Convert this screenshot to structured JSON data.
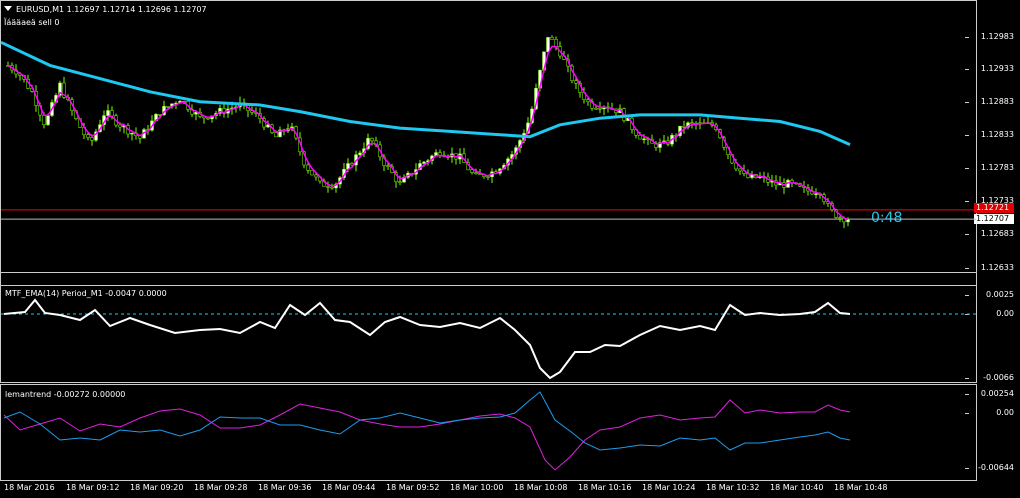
{
  "header": {
    "symbol_line": "EURUSD,M1  1.12697 1.12714 1.12696 1.12707",
    "subtitle": "Ïáääaeä sell 0"
  },
  "main_axis": [
    "1.12983",
    "1.12933",
    "1.12883",
    "1.12833",
    "1.12783",
    "1.12733",
    "1.12683",
    "1.12633"
  ],
  "current_price": "1.12707",
  "red_level": "1.12721",
  "countdown": "0:48",
  "indicator1": {
    "title": "MTF_EMA(14) Period_M1 -0.0047 0.0000",
    "axis": [
      "0.0025",
      "0.00",
      "-0.0066"
    ]
  },
  "indicator2": {
    "title": "lemantrend -0.00272 0.00000",
    "axis": [
      "0.00254",
      "0.00",
      "-0.00644"
    ]
  },
  "time_axis": [
    "18 Mar 2016",
    "18 Mar 09:12",
    "18 Mar 09:20",
    "18 Mar 09:28",
    "18 Mar 09:36",
    "18 Mar 09:44",
    "18 Mar 09:52",
    "18 Mar 10:00",
    "18 Mar 10:08",
    "18 Mar 10:16",
    "18 Mar 10:24",
    "18 Mar 10:32",
    "18 Mar 10:40",
    "18 Mar 10:48"
  ],
  "colors": {
    "bull_candle": "#ffffff",
    "bear_candle": "#000000",
    "wick": "#7fff00",
    "ma_fast": "#ff00ff",
    "ma_slow": "#1ec8f0",
    "red_line": "#ff0000",
    "ema_line": "#ffffff",
    "trend_pink": "#e020e0",
    "trend_blue": "#1e9cf0"
  }
}
